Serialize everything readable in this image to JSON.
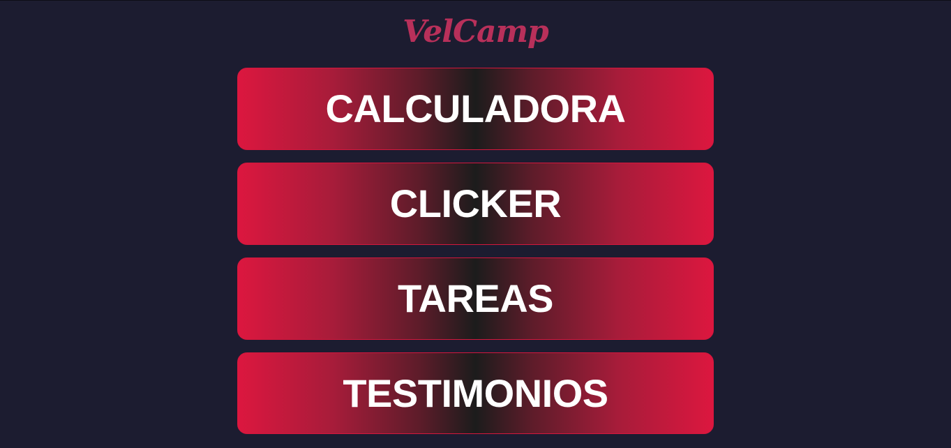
{
  "brand": {
    "title": "VelCamp",
    "color": "#b8305a"
  },
  "theme": {
    "background": "#1c1c30",
    "button_edge": "#dc173f",
    "button_center": "#1c1c1c",
    "label_color": "#ffffff"
  },
  "menu": {
    "items": [
      {
        "label": "CALCULADORA"
      },
      {
        "label": "CLICKER"
      },
      {
        "label": "TAREAS"
      },
      {
        "label": "TESTIMONIOS"
      }
    ]
  }
}
